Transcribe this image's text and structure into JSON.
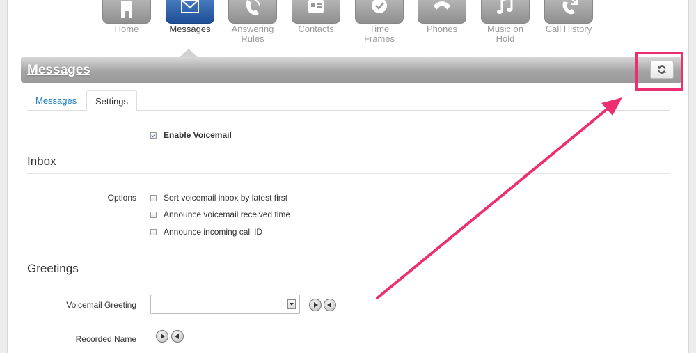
{
  "nav": {
    "items": [
      {
        "label": "Home",
        "icon": "home-icon"
      },
      {
        "label": "Messages",
        "icon": "envelope-icon"
      },
      {
        "label": "Answering\nRules",
        "icon": "phone-rules-icon"
      },
      {
        "label": "Contacts",
        "icon": "contacts-card-icon"
      },
      {
        "label": "Time\nFrames",
        "icon": "clock-icon"
      },
      {
        "label": "Phones",
        "icon": "phone-handset-icon"
      },
      {
        "label": "Music on\nHold",
        "icon": "music-note-icon"
      },
      {
        "label": "Call History",
        "icon": "call-history-icon"
      }
    ],
    "active": "Messages"
  },
  "page": {
    "title": "Messages",
    "refresh_icon": "refresh-icon"
  },
  "tabs": [
    {
      "label": "Messages",
      "active": false
    },
    {
      "label": "Settings",
      "active": true
    }
  ],
  "settings": {
    "enable_voicemail": {
      "label": "Enable Voicemail",
      "checked": true
    },
    "inbox": {
      "title": "Inbox",
      "options_label": "Options",
      "options": [
        {
          "label": "Sort voicemail inbox by latest first",
          "checked": false
        },
        {
          "label": "Announce voicemail received time",
          "checked": false
        },
        {
          "label": "Announce incoming call ID",
          "checked": false
        }
      ]
    },
    "greetings": {
      "title": "Greetings",
      "voicemail_greeting_label": "Voicemail Greeting",
      "voicemail_greeting_value": "",
      "recorded_name_label": "Recorded Name"
    }
  },
  "colors": {
    "annotation": "#ee2e73",
    "active_nav": "#2b5ea8",
    "link": "#1a7bc4"
  }
}
